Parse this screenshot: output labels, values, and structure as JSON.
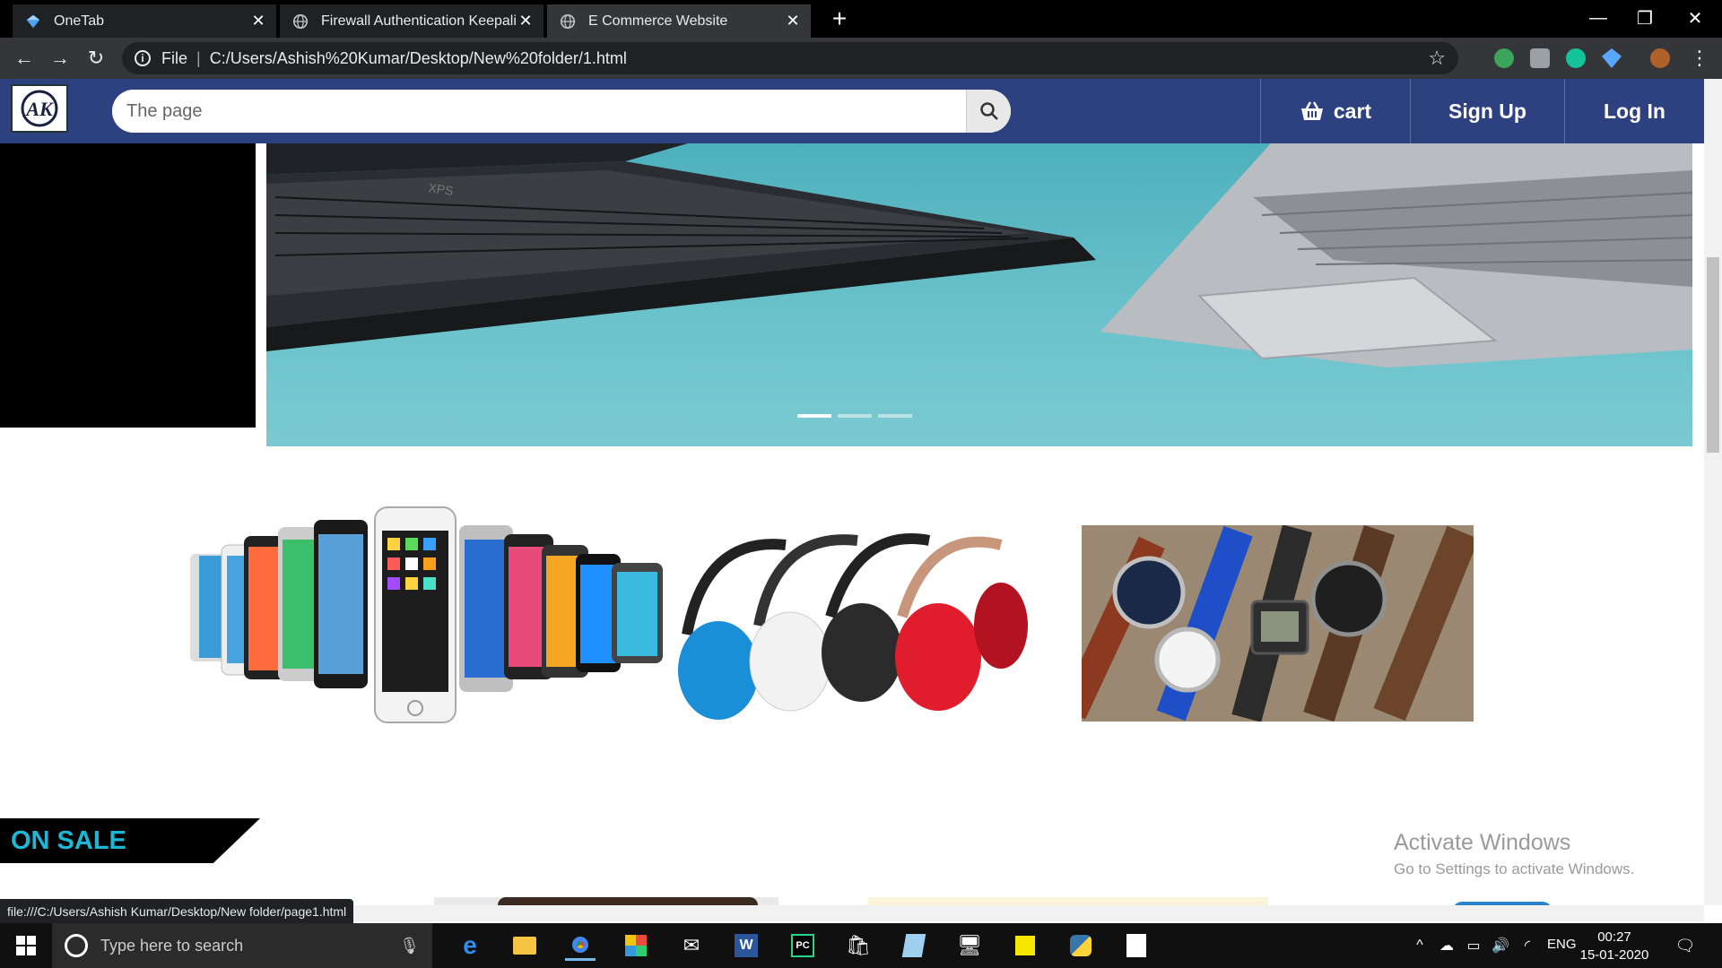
{
  "browser": {
    "tabs": [
      {
        "title": "OneTab",
        "active": false
      },
      {
        "title": "Firewall Authentication Keepalive",
        "active": false
      },
      {
        "title": "E Commerce Website",
        "active": true
      }
    ],
    "address": {
      "scheme": "File",
      "url": "C:/Users/Ashish%20Kumar/Desktop/New%20folder/1.html"
    },
    "status_url": "file:///C:/Users/Ashish Kumar/Desktop/New folder/page1.html"
  },
  "site": {
    "logo_text": "AK",
    "search": {
      "placeholder": "The page"
    },
    "nav": {
      "cart": "cart",
      "signup": "Sign Up",
      "login": "Log In"
    },
    "carousel": {
      "slide_count": 3,
      "active_index": 0
    },
    "categories": [
      "phones",
      "headphones",
      "watches"
    ],
    "sale_label": "ON SALE"
  },
  "watermark": {
    "line1": "Activate Windows",
    "line2": "Go to Settings to activate Windows."
  },
  "taskbar": {
    "search_placeholder": "Type here to search",
    "language": "ENG",
    "time": "00:27",
    "date": "15-01-2020"
  },
  "colors": {
    "nav": "#2d4180",
    "sale_text": "#1bb7d5",
    "hero": "#5bb8c3"
  }
}
